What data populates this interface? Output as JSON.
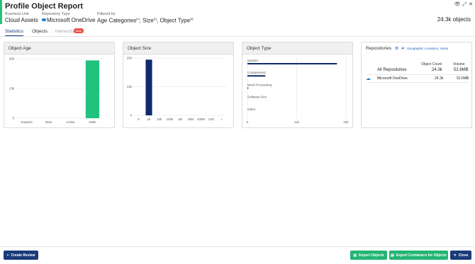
{
  "header": {
    "title": "Profile Object Report",
    "business_unit_label": "Business Unit",
    "business_unit_value": "Cloud Assets",
    "repository_type_label": "Repository Type",
    "repository_type_value": "Microsoft OneDrive",
    "filtered_by_label": "Filtered by",
    "filter_age": "Age Categories",
    "filter_age_count": "[1]",
    "filter_size": "Size",
    "filter_size_count": "[1]",
    "filter_type": "Object Type",
    "filter_type_count": "[4]",
    "total_objects": "24.3k objects",
    "icons": [
      "eye-icon",
      "expand-icon",
      "close-icon"
    ]
  },
  "tabs": [
    {
      "label": "Statistics",
      "active": true
    },
    {
      "label": "Objects",
      "active": false
    },
    {
      "label": "Hierarchy",
      "active": false,
      "disabled": true,
      "badge": "beta"
    }
  ],
  "panels": {
    "age_title": "Object Age",
    "size_title": "Object Size",
    "type_title": "Object Type",
    "repo_title": "Repositories",
    "repo_link": "Geographic Locations, Hosts"
  },
  "chart_data": [
    {
      "type": "bar",
      "title": "Object Age",
      "categories": [
        "Suspect",
        "New",
        "Active",
        "Stale"
      ],
      "values": [
        0,
        0,
        0,
        24300
      ],
      "y_ticks": [
        "25k",
        "13k",
        "0"
      ],
      "ylim": [
        0,
        25000
      ],
      "color": "#22c17e"
    },
    {
      "type": "bar",
      "title": "Object Size",
      "categories": [
        "0",
        "1k",
        "10k",
        "100k",
        "1M",
        "10M",
        "100M",
        "10G",
        "+"
      ],
      "values": [
        0,
        24300,
        0,
        0,
        0,
        0,
        0,
        0,
        0
      ],
      "y_ticks": [
        "25k",
        "13k",
        "0"
      ],
      "ylim": [
        0,
        25000
      ],
      "color": "#0f2a6b"
    },
    {
      "type": "bar",
      "orientation": "horizontal",
      "title": "Object Type",
      "categories": [
        "System",
        "Compressed",
        "Word Processing",
        "Software Dev",
        "Other"
      ],
      "values": [
        20000,
        4000,
        150,
        0,
        0
      ],
      "x_ticks": [
        "0",
        "11k",
        "22k"
      ],
      "xlim": [
        0,
        22000
      ],
      "color": "#0f2a6b"
    }
  ],
  "repositories": {
    "columns": [
      "Object Count",
      "Volume"
    ],
    "rows": [
      {
        "name": "All Repositories",
        "count": "24.3k",
        "volume": "52.6MB",
        "icon": null
      },
      {
        "name": "Microsoft OneDrive",
        "count": "24.3k",
        "volume": "52.6MB",
        "icon": "onedrive-cloud-icon"
      }
    ]
  },
  "footer": {
    "create_review": "Create Review",
    "export_objects": "Export Objects",
    "export_containers": "Export Containers for Objects",
    "close": "Close"
  }
}
